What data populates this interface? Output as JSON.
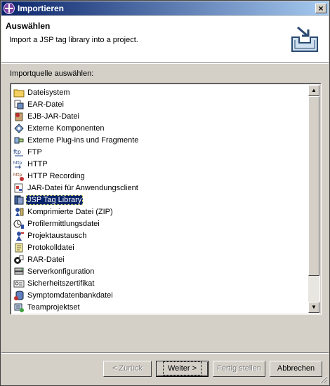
{
  "window": {
    "title": "Importieren",
    "close_glyph": "×"
  },
  "banner": {
    "heading": "Auswählen",
    "description": "Import a JSP tag library into a project.",
    "icon": "import-wizard-icon"
  },
  "source": {
    "label": "Importquelle auswählen:",
    "items": [
      {
        "label": "Dateisystem",
        "icon": "folder-icon"
      },
      {
        "label": "EAR-Datei",
        "icon": "ear-file-icon"
      },
      {
        "label": "EJB-JAR-Datei",
        "icon": "ejb-jar-icon"
      },
      {
        "label": "Externe Komponenten",
        "icon": "external-components-icon"
      },
      {
        "label": "Externe Plug-ins und Fragmente",
        "icon": "plugins-icon"
      },
      {
        "label": "FTP",
        "icon": "ftp-icon"
      },
      {
        "label": "HTTP",
        "icon": "http-icon"
      },
      {
        "label": "HTTP Recording",
        "icon": "http-recording-icon"
      },
      {
        "label": "JAR-Datei für Anwendungsclient",
        "icon": "jar-client-icon"
      },
      {
        "label": "JSP Tag Library",
        "icon": "jsp-taglib-icon",
        "selected": true
      },
      {
        "label": "Komprimierte Datei (ZIP)",
        "icon": "zip-icon"
      },
      {
        "label": "Profilermittlungsdatei",
        "icon": "profiler-icon"
      },
      {
        "label": "Projektaustausch",
        "icon": "project-exchange-icon"
      },
      {
        "label": "Protokolldatei",
        "icon": "log-file-icon"
      },
      {
        "label": "RAR-Datei",
        "icon": "rar-file-icon"
      },
      {
        "label": "Serverkonfiguration",
        "icon": "server-config-icon"
      },
      {
        "label": "Sicherheitszertifikat",
        "icon": "certificate-icon"
      },
      {
        "label": "Symptomdatenbankdatei",
        "icon": "symptom-db-icon"
      },
      {
        "label": "Teamprojektset",
        "icon": "team-project-icon"
      }
    ]
  },
  "buttons": {
    "back": "< Zurück",
    "next": "Weiter >",
    "finish": "Fertig stellen",
    "cancel": "Abbrechen"
  },
  "colors": {
    "title_start": "#0a246a",
    "title_end": "#a6caf0",
    "selection": "#0a246a",
    "dialog_bg": "#d4d0c8"
  }
}
